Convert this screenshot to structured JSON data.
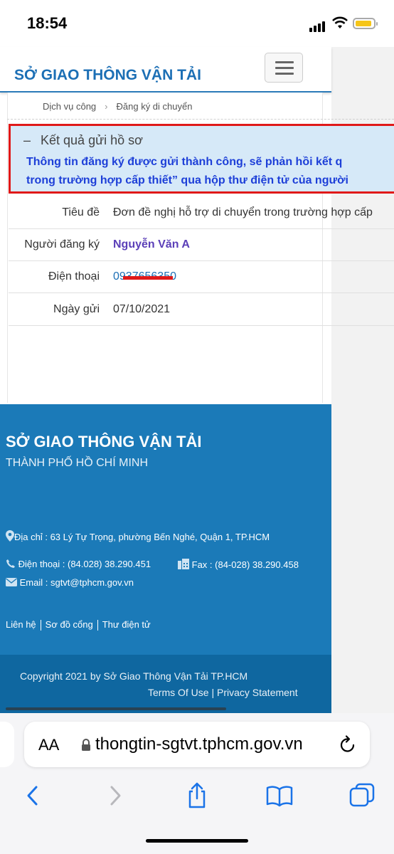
{
  "status_bar": {
    "time": "18:54"
  },
  "header": {
    "site_title": "SỞ GIAO THÔNG VẬN TẢI TP.HCM"
  },
  "breadcrumb": {
    "item1": "Dịch vụ công",
    "item2": "Đăng ký di chuyển"
  },
  "result": {
    "title": "Kết quả gửi hồ sơ",
    "message_line1": "Thông tin đăng ký được gửi thành công, sẽ phản hồi kết q",
    "message_line2": "trong trường hợp cấp thiết” qua hộp thư điện tử của người"
  },
  "details": [
    {
      "label": "Tiêu đề",
      "value": "Đơn đề nghị hỗ trợ di chuyển trong trường hợp cấp"
    },
    {
      "label": "Người đăng ký",
      "value": "Nguyễn Văn A"
    },
    {
      "label": "Điện thoại",
      "value": "0937656350"
    },
    {
      "label": "Ngày gửi",
      "value": "07/10/2021"
    }
  ],
  "footer": {
    "title": "SỞ GIAO THÔNG VẬN TẢI",
    "subtitle": "THÀNH PHỐ HỒ CHÍ MINH",
    "address": "Địa chỉ : 63 Lý Tự Trọng, phường Bến Nghé, Quận 1, TP.HCM",
    "phone": "Điện thoại : (84.028) 38.290.451",
    "fax": "Fax : (84-028) 38.290.458",
    "email": "Email : sgtvt@tphcm.gov.vn",
    "links": [
      "Liên hệ",
      "Sơ đồ cổng",
      "Thư điện tử"
    ],
    "copyright": "Copyright 2021 by Sở Giao Thông Vận Tải TP.HCM",
    "terms": "Terms Of Use",
    "privacy": "Privacy Statement"
  },
  "browser": {
    "aa_label": "AA",
    "url": "thongtin-sgtvt.tphcm.gov.vn",
    "icons": [
      "lock-icon",
      "reload-icon",
      "back-icon",
      "forward-icon",
      "share-icon",
      "bookmarks-icon",
      "tabs-icon"
    ]
  },
  "colors": {
    "brand_blue": "#1c6fb5",
    "footer_blue": "#1b7ab8",
    "highlight_red": "#e01919",
    "message_blue": "#1d3fd8"
  }
}
